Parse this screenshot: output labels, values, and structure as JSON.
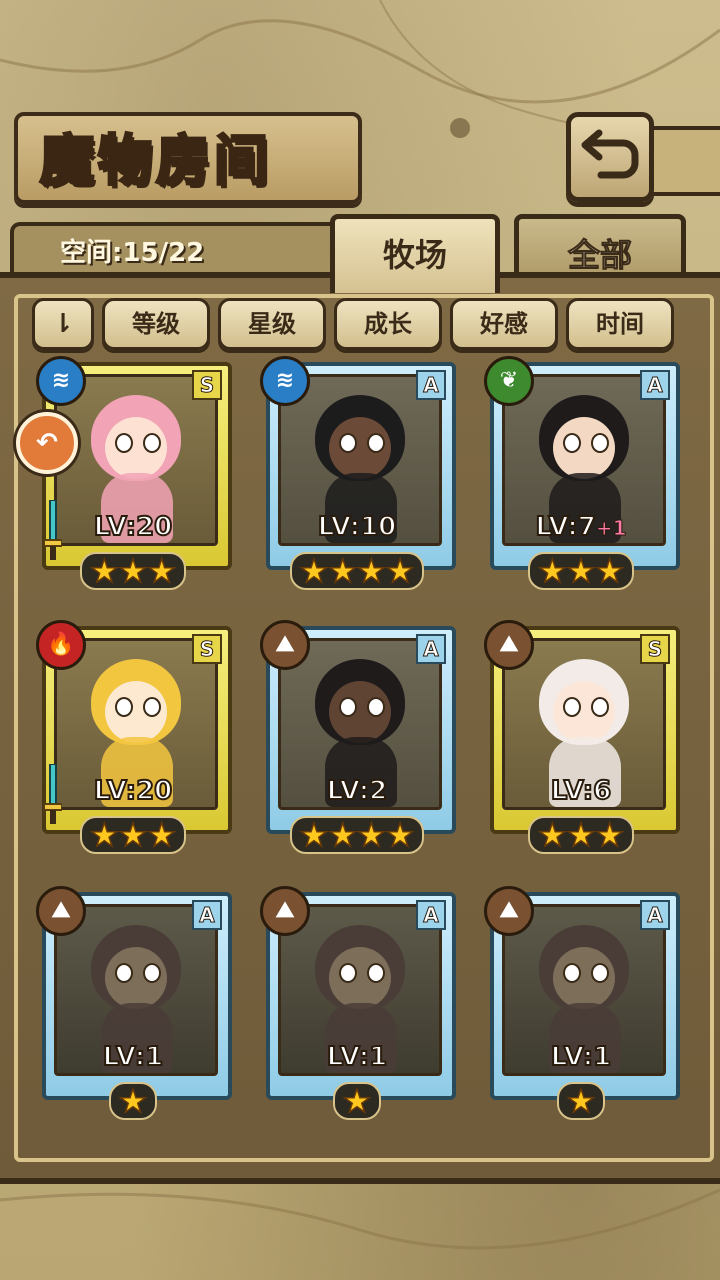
{
  "header": {
    "title": "魔物房间"
  },
  "space": {
    "label": "空间:15/22"
  },
  "tabs": [
    {
      "label": "牧场",
      "active": true
    },
    {
      "label": "全部",
      "active": false
    }
  ],
  "sort": {
    "toggle": "⇂",
    "buttons": [
      "等级",
      "星级",
      "成长",
      "好感",
      "时间"
    ]
  },
  "cards": [
    {
      "rank": "S",
      "element": "water",
      "level": "LV:20",
      "plus": "",
      "stars": 3,
      "frame": "gold",
      "hair": "#f2a3b5",
      "skin": "#fde2d4"
    },
    {
      "rank": "A",
      "element": "water",
      "level": "LV:10",
      "plus": "",
      "stars": 4,
      "frame": "blue",
      "hair": "#1c1c1c",
      "skin": "#6b4a38"
    },
    {
      "rank": "A",
      "element": "leaf",
      "level": "LV:7",
      "plus": "+1",
      "stars": 3,
      "frame": "blue",
      "hair": "#1f1b1b",
      "skin": "#f3d8c3"
    },
    {
      "rank": "S",
      "element": "fire",
      "level": "LV:20",
      "plus": "",
      "stars": 3,
      "frame": "gold",
      "hair": "#f3c640",
      "skin": "#fde8d0"
    },
    {
      "rank": "A",
      "element": "earth",
      "level": "LV:2",
      "plus": "",
      "stars": 4,
      "frame": "blue",
      "hair": "#1f1b1b",
      "skin": "#5f4434"
    },
    {
      "rank": "S",
      "element": "earth",
      "level": "LV:6",
      "plus": "",
      "stars": 3,
      "frame": "gold",
      "hair": "#f2ebe7",
      "skin": "#fbe6d7"
    },
    {
      "rank": "A",
      "element": "earth",
      "level": "LV:1",
      "plus": "",
      "stars": 1,
      "frame": "blue",
      "hair": "#4a3c37",
      "skin": "#7d6e5a"
    },
    {
      "rank": "A",
      "element": "earth",
      "level": "LV:1",
      "plus": "",
      "stars": 1,
      "frame": "blue",
      "hair": "#4a3c37",
      "skin": "#7d6e5a"
    },
    {
      "rank": "A",
      "element": "earth",
      "level": "LV:1",
      "plus": "",
      "stars": 1,
      "frame": "blue",
      "hair": "#4a3c37",
      "skin": "#7d6e5a"
    }
  ]
}
